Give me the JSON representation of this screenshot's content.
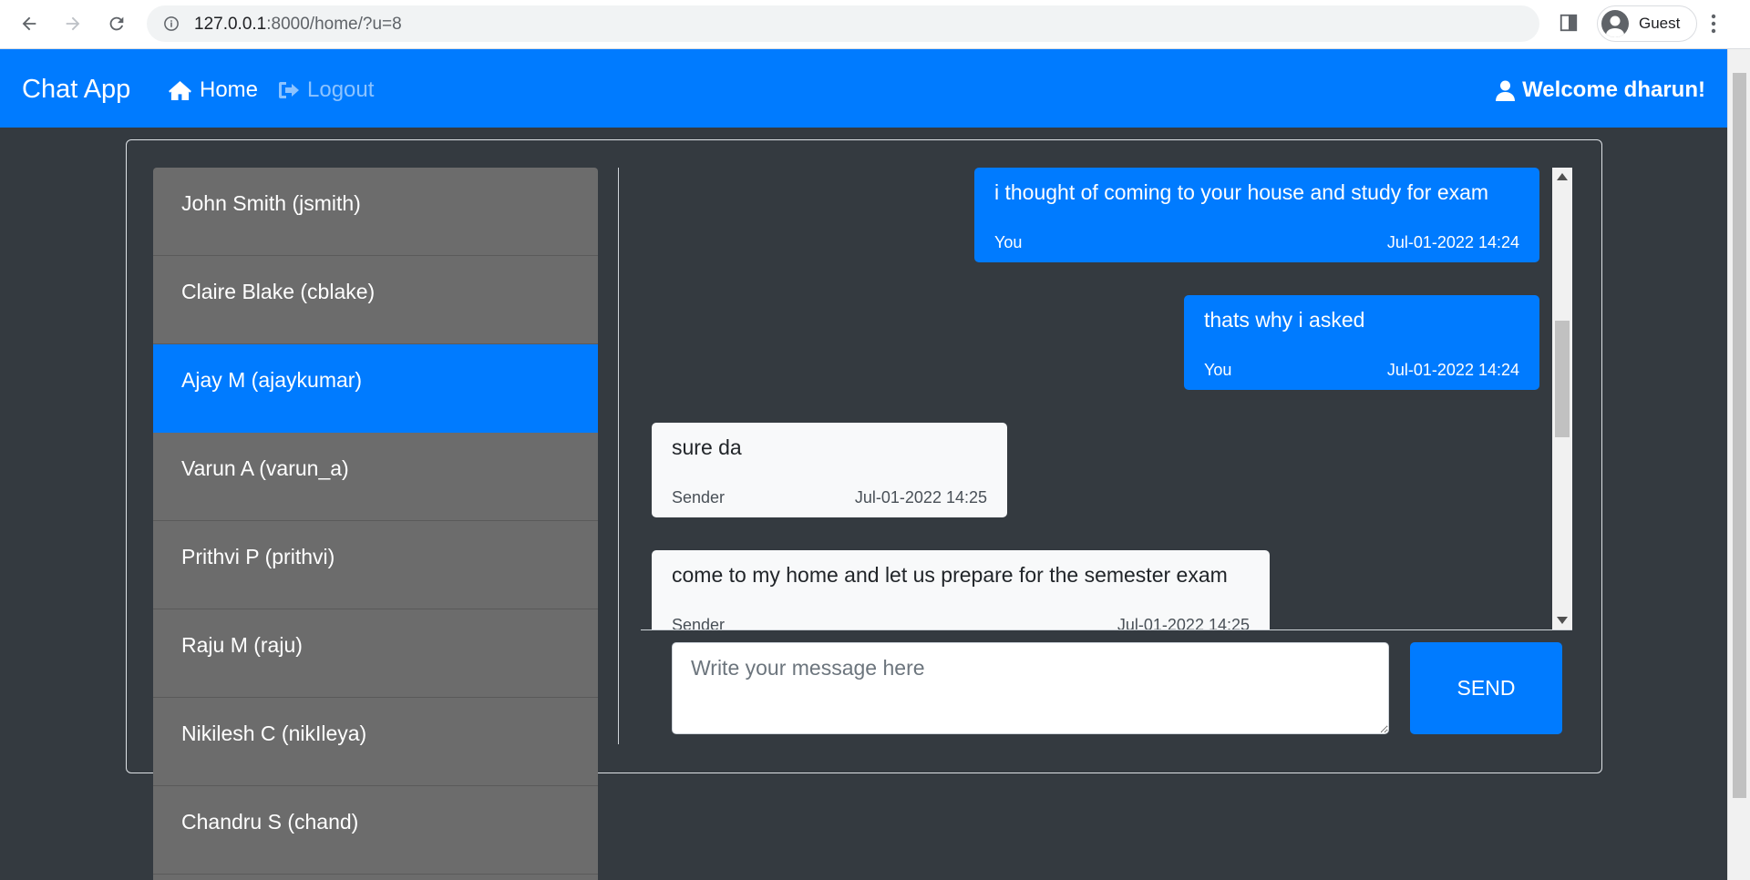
{
  "browser": {
    "url_host": "127.0.0.1",
    "url_rest": ":8000/home/?u=8",
    "profile_name": "Guest"
  },
  "navbar": {
    "brand": "Chat App",
    "home_label": "Home",
    "logout_label": "Logout",
    "welcome": "Welcome dharun!"
  },
  "users": [
    {
      "label": "John Smith (jsmith)",
      "active": false
    },
    {
      "label": "Claire Blake (cblake)",
      "active": false
    },
    {
      "label": "Ajay M (ajaykumar)",
      "active": true
    },
    {
      "label": "Varun A (varun_a)",
      "active": false
    },
    {
      "label": "Prithvi P (prithvi)",
      "active": false
    },
    {
      "label": "Raju M (raju)",
      "active": false
    },
    {
      "label": "Nikilesh C (nikIleya)",
      "active": false
    },
    {
      "label": "Chandru S (chand)",
      "active": false
    }
  ],
  "messages": [
    {
      "text": "i thought of coming to your house and study for exam",
      "author": "You",
      "time": "Jul-01-2022 14:24"
    },
    {
      "text": "thats why i asked",
      "author": "You",
      "time": "Jul-01-2022 14:24"
    },
    {
      "text": "sure da",
      "author": "Sender",
      "time": "Jul-01-2022 14:25"
    },
    {
      "text": "come to my home and let us prepare for the semester exam",
      "author": "Sender",
      "time": "Jul-01-2022 14:25"
    }
  ],
  "composer": {
    "placeholder": "Write your message here",
    "value": ""
  },
  "send_label": "SEND",
  "colors": {
    "primary": "#007bff",
    "background": "#343a40",
    "user_list": "#6c6c6c"
  }
}
